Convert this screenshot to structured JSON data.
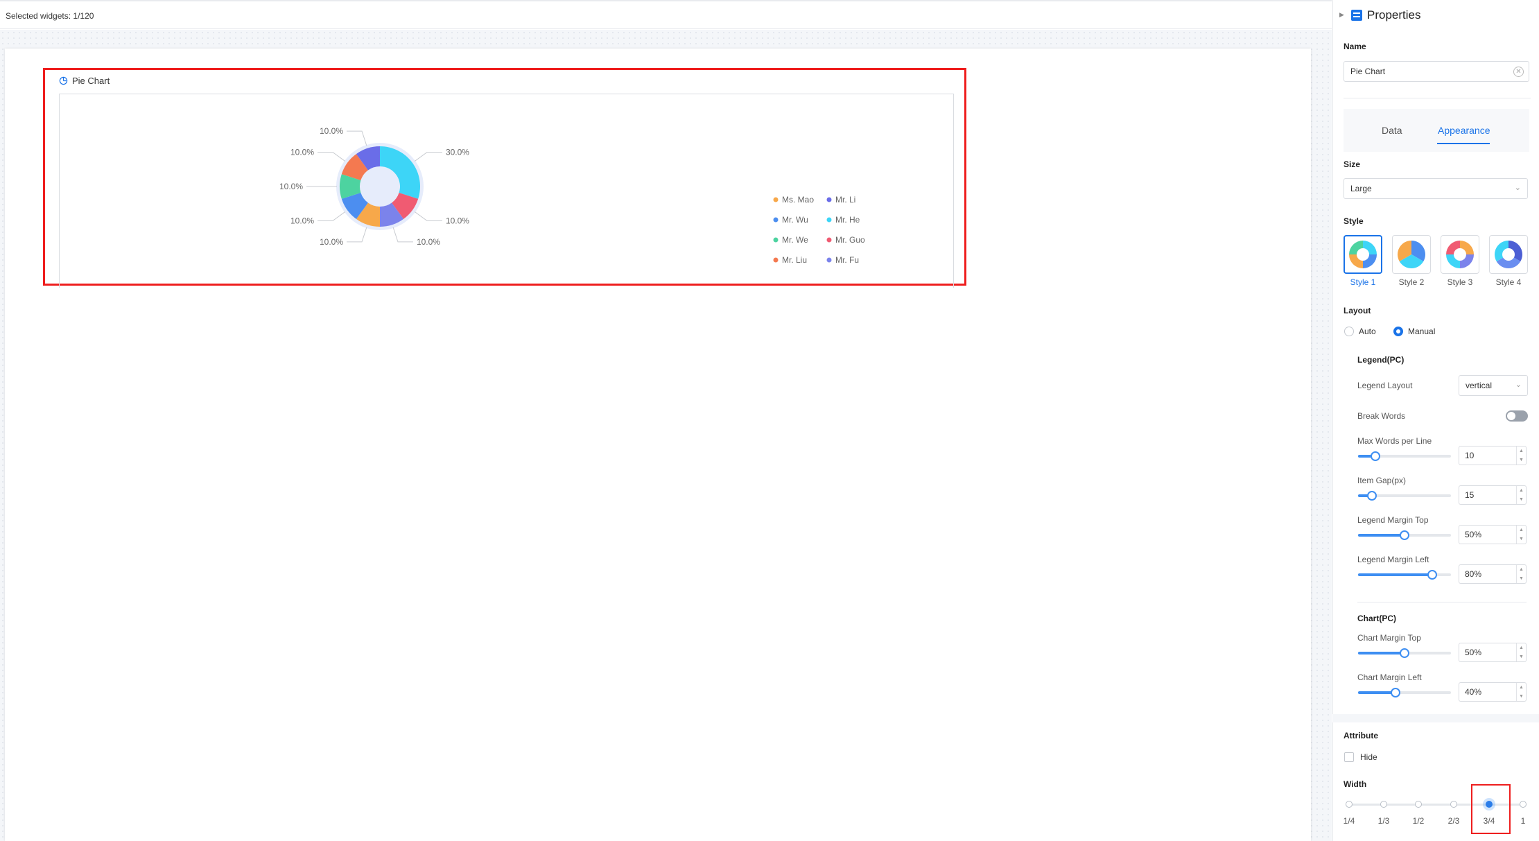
{
  "topbar": {
    "selected_widgets": "Selected widgets: 1/120"
  },
  "widget": {
    "title": "Pie Chart"
  },
  "chart_data": {
    "type": "pie",
    "variant": "donut",
    "categories": [
      "Mr. He",
      "Mr. Guo",
      "Mr. Fu",
      "Ms. Mao",
      "Mr. Wu",
      "Mr. We",
      "Mr. Liu",
      "Mr. Li"
    ],
    "values": [
      30,
      10,
      10,
      10,
      10,
      10,
      10,
      10
    ],
    "value_labels": [
      "30.0%",
      "10.0%",
      "10.0%",
      "10.0%",
      "10.0%",
      "10.0%",
      "10.0%",
      "10.0%"
    ],
    "colors": [
      "#3dd5f7",
      "#f05b72",
      "#7b83eb",
      "#f7a84a",
      "#4c8ef0",
      "#4dd3a0",
      "#f47950",
      "#6a6de8"
    ],
    "legend": {
      "placement": "right",
      "entries": [
        {
          "name": "Ms. Mao",
          "color": "#f7a84a"
        },
        {
          "name": "Mr. Li",
          "color": "#6a6de8"
        },
        {
          "name": "Mr. Wu",
          "color": "#4c8ef0"
        },
        {
          "name": "Mr. He",
          "color": "#3dd5f7"
        },
        {
          "name": "Mr. We",
          "color": "#4dd3a0"
        },
        {
          "name": "Mr. Guo",
          "color": "#f05b72"
        },
        {
          "name": "Mr. Liu",
          "color": "#f47950"
        },
        {
          "name": "Mr. Fu",
          "color": "#7b83eb"
        }
      ]
    }
  },
  "panel": {
    "title": "Properties",
    "name_label": "Name",
    "name_value": "Pie Chart",
    "tabs": [
      {
        "label": "Data",
        "active": false
      },
      {
        "label": "Appearance",
        "active": true
      }
    ],
    "size_label": "Size",
    "size_value": "Large",
    "style_label": "Style",
    "styles": [
      {
        "label": "Style 1",
        "selected": true
      },
      {
        "label": "Style 2",
        "selected": false
      },
      {
        "label": "Style 3",
        "selected": false
      },
      {
        "label": "Style 4",
        "selected": false
      }
    ],
    "layout_label": "Layout",
    "layout_options": [
      {
        "label": "Auto",
        "selected": false
      },
      {
        "label": "Manual",
        "selected": true
      }
    ],
    "legend_section": "Legend(PC)",
    "legend_layout_label": "Legend Layout",
    "legend_layout_value": "vertical",
    "break_words_label": "Break Words",
    "break_words_on": false,
    "legend_sliders": [
      {
        "label": "Max Words per Line",
        "value": "10",
        "fraction": 0.19
      },
      {
        "label": "Item Gap(px)",
        "value": "15",
        "fraction": 0.15
      },
      {
        "label": "Legend Margin Top",
        "value": "50%",
        "fraction": 0.5
      },
      {
        "label": "Legend Margin Left",
        "value": "80%",
        "fraction": 0.8
      }
    ],
    "chart_section": "Chart(PC)",
    "chart_sliders": [
      {
        "label": "Chart Margin Top",
        "value": "50%",
        "fraction": 0.5
      },
      {
        "label": "Chart Margin Left",
        "value": "40%",
        "fraction": 0.4
      }
    ],
    "attribute_label": "Attribute",
    "hide_label": "Hide",
    "width_label": "Width",
    "width_options": [
      "1/4",
      "1/3",
      "1/2",
      "2/3",
      "3/4",
      "1"
    ],
    "width_selected": "3/4"
  }
}
